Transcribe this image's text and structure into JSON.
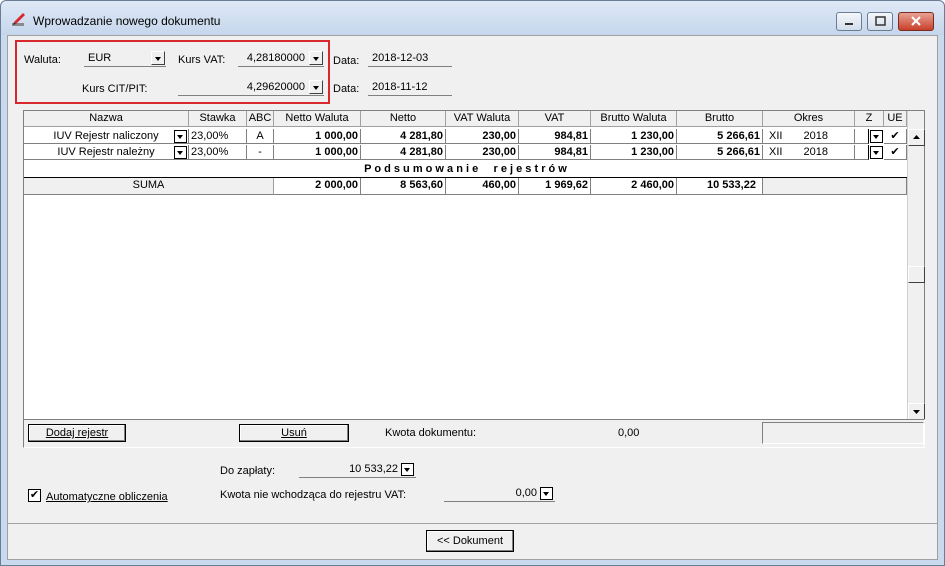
{
  "window": {
    "title": "Wprowadzanie nowego dokumentu"
  },
  "currency": {
    "waluta_label": "Waluta:",
    "waluta_value": "EUR",
    "kurs_vat_label": "Kurs VAT:",
    "kurs_vat_value": "4,28180000",
    "kurs_cit_label": "Kurs CIT/PIT:",
    "kurs_cit_value": "4,29620000",
    "data_label_1": "Data:",
    "data_value_1": "2018-12-03",
    "data_label_2": "Data:",
    "data_value_2": "2018-11-12"
  },
  "table": {
    "headers": [
      "Nazwa",
      "Stawka",
      "ABC",
      "Netto Waluta",
      "Netto",
      "VAT Waluta",
      "VAT",
      "Brutto Waluta",
      "Brutto",
      "Okres",
      "Z",
      "UE"
    ],
    "rows": [
      {
        "nazwa": "IUV Rejestr naliczony",
        "stawka": "23,00%",
        "abc": "A",
        "netto_waluta": "1 000,00",
        "netto": "4 281,80",
        "vat_waluta": "230,00",
        "vat": "984,81",
        "brutto_waluta": "1 230,00",
        "brutto": "5 266,61",
        "okres_m": "XII",
        "okres_y": "2018",
        "ue": "✔"
      },
      {
        "nazwa": "IUV Rejestr należny",
        "stawka": "23,00%",
        "abc": "-",
        "netto_waluta": "1 000,00",
        "netto": "4 281,80",
        "vat_waluta": "230,00",
        "vat": "984,81",
        "brutto_waluta": "1 230,00",
        "brutto": "5 266,61",
        "okres_m": "XII",
        "okres_y": "2018",
        "ue": "✔"
      }
    ],
    "summary_title": "P o d s u m o w a n i e     r e j e s t r ó w",
    "suma": {
      "label": "SUMA",
      "netto_waluta": "2 000,00",
      "netto": "8 563,60",
      "vat_waluta": "460,00",
      "vat": "1 969,62",
      "brutto_waluta": "2 460,00",
      "brutto": "10 533,22"
    }
  },
  "actions": {
    "dodaj_rejestr": "Dodaj rejestr",
    "usun": "Usuń",
    "kwota_dokumentu_label": "Kwota dokumentu:",
    "kwota_dokumentu_value": "0,00"
  },
  "bottom": {
    "do_zaplaty_label": "Do zapłaty:",
    "do_zaplaty_value": "10 533,22",
    "auto_label": "Automatyczne obliczenia",
    "auto_checked": "✔",
    "kwota_nie_label": "Kwota nie wchodząca do rejestru VAT:",
    "kwota_nie_value": "0,00",
    "dokument_button": "<< Dokument"
  }
}
